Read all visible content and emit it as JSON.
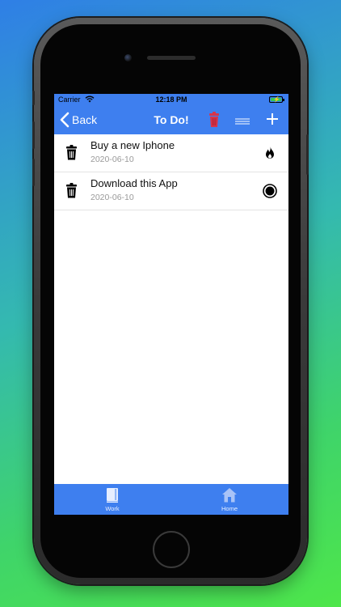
{
  "status_bar": {
    "carrier": "Carrier",
    "time": "12:18 PM",
    "battery_icon": "battery-charging-icon",
    "wifi_icon": "wifi-icon"
  },
  "nav": {
    "back_label": "Back",
    "title": "To Do!",
    "icons": [
      "chevron-left-icon",
      "trash-icon",
      "lines-icon",
      "plus-icon"
    ]
  },
  "todos": [
    {
      "title": "Buy a new Iphone",
      "date": "2020-06-10",
      "status_icon": "fire-icon"
    },
    {
      "title": "Download this App",
      "date": "2020-06-10",
      "status_icon": "radio-circle-icon"
    }
  ],
  "tab_bar": {
    "tabs": [
      {
        "label": "Work",
        "icon": "book-icon",
        "selected": true
      },
      {
        "label": "Home",
        "icon": "house-icon",
        "selected": false
      }
    ]
  },
  "colors": {
    "accent": "#3e7fef",
    "trash_red": "#d9344a",
    "background_gradient": [
      "#2f7fe6",
      "#4ee64a"
    ]
  }
}
